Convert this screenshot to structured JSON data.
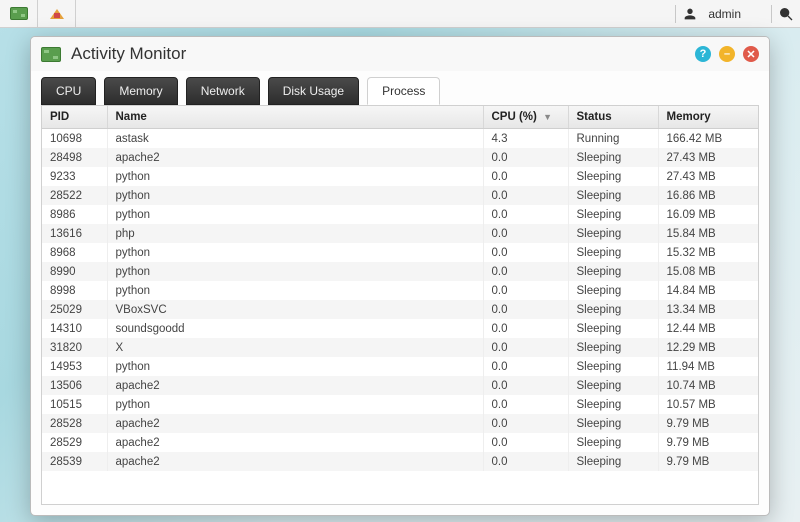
{
  "topbar": {
    "user_label": "admin"
  },
  "window": {
    "title": "Activity Monitor",
    "tabs": [
      {
        "label": "CPU",
        "active": false
      },
      {
        "label": "Memory",
        "active": false
      },
      {
        "label": "Network",
        "active": false
      },
      {
        "label": "Disk Usage",
        "active": false
      },
      {
        "label": "Process",
        "active": true
      }
    ],
    "columns": {
      "pid": "PID",
      "name": "Name",
      "cpu": "CPU (%)",
      "status": "Status",
      "memory": "Memory"
    },
    "rows": [
      {
        "pid": "10698",
        "name": "astask",
        "cpu": "4.3",
        "status": "Running",
        "memory": "166.42 MB"
      },
      {
        "pid": "28498",
        "name": "apache2",
        "cpu": "0.0",
        "status": "Sleeping",
        "memory": "27.43 MB"
      },
      {
        "pid": "9233",
        "name": "python",
        "cpu": "0.0",
        "status": "Sleeping",
        "memory": "27.43 MB"
      },
      {
        "pid": "28522",
        "name": "python",
        "cpu": "0.0",
        "status": "Sleeping",
        "memory": "16.86 MB"
      },
      {
        "pid": "8986",
        "name": "python",
        "cpu": "0.0",
        "status": "Sleeping",
        "memory": "16.09 MB"
      },
      {
        "pid": "13616",
        "name": "php",
        "cpu": "0.0",
        "status": "Sleeping",
        "memory": "15.84 MB"
      },
      {
        "pid": "8968",
        "name": "python",
        "cpu": "0.0",
        "status": "Sleeping",
        "memory": "15.32 MB"
      },
      {
        "pid": "8990",
        "name": "python",
        "cpu": "0.0",
        "status": "Sleeping",
        "memory": "15.08 MB"
      },
      {
        "pid": "8998",
        "name": "python",
        "cpu": "0.0",
        "status": "Sleeping",
        "memory": "14.84 MB"
      },
      {
        "pid": "25029",
        "name": "VBoxSVC",
        "cpu": "0.0",
        "status": "Sleeping",
        "memory": "13.34 MB"
      },
      {
        "pid": "14310",
        "name": "soundsgoodd",
        "cpu": "0.0",
        "status": "Sleeping",
        "memory": "12.44 MB"
      },
      {
        "pid": "31820",
        "name": "X",
        "cpu": "0.0",
        "status": "Sleeping",
        "memory": "12.29 MB"
      },
      {
        "pid": "14953",
        "name": "python",
        "cpu": "0.0",
        "status": "Sleeping",
        "memory": "11.94 MB"
      },
      {
        "pid": "13506",
        "name": "apache2",
        "cpu": "0.0",
        "status": "Sleeping",
        "memory": "10.74 MB"
      },
      {
        "pid": "10515",
        "name": "python",
        "cpu": "0.0",
        "status": "Sleeping",
        "memory": "10.57 MB"
      },
      {
        "pid": "28528",
        "name": "apache2",
        "cpu": "0.0",
        "status": "Sleeping",
        "memory": "9.79 MB"
      },
      {
        "pid": "28529",
        "name": "apache2",
        "cpu": "0.0",
        "status": "Sleeping",
        "memory": "9.79 MB"
      },
      {
        "pid": "28539",
        "name": "apache2",
        "cpu": "0.0",
        "status": "Sleeping",
        "memory": "9.79 MB"
      }
    ]
  }
}
